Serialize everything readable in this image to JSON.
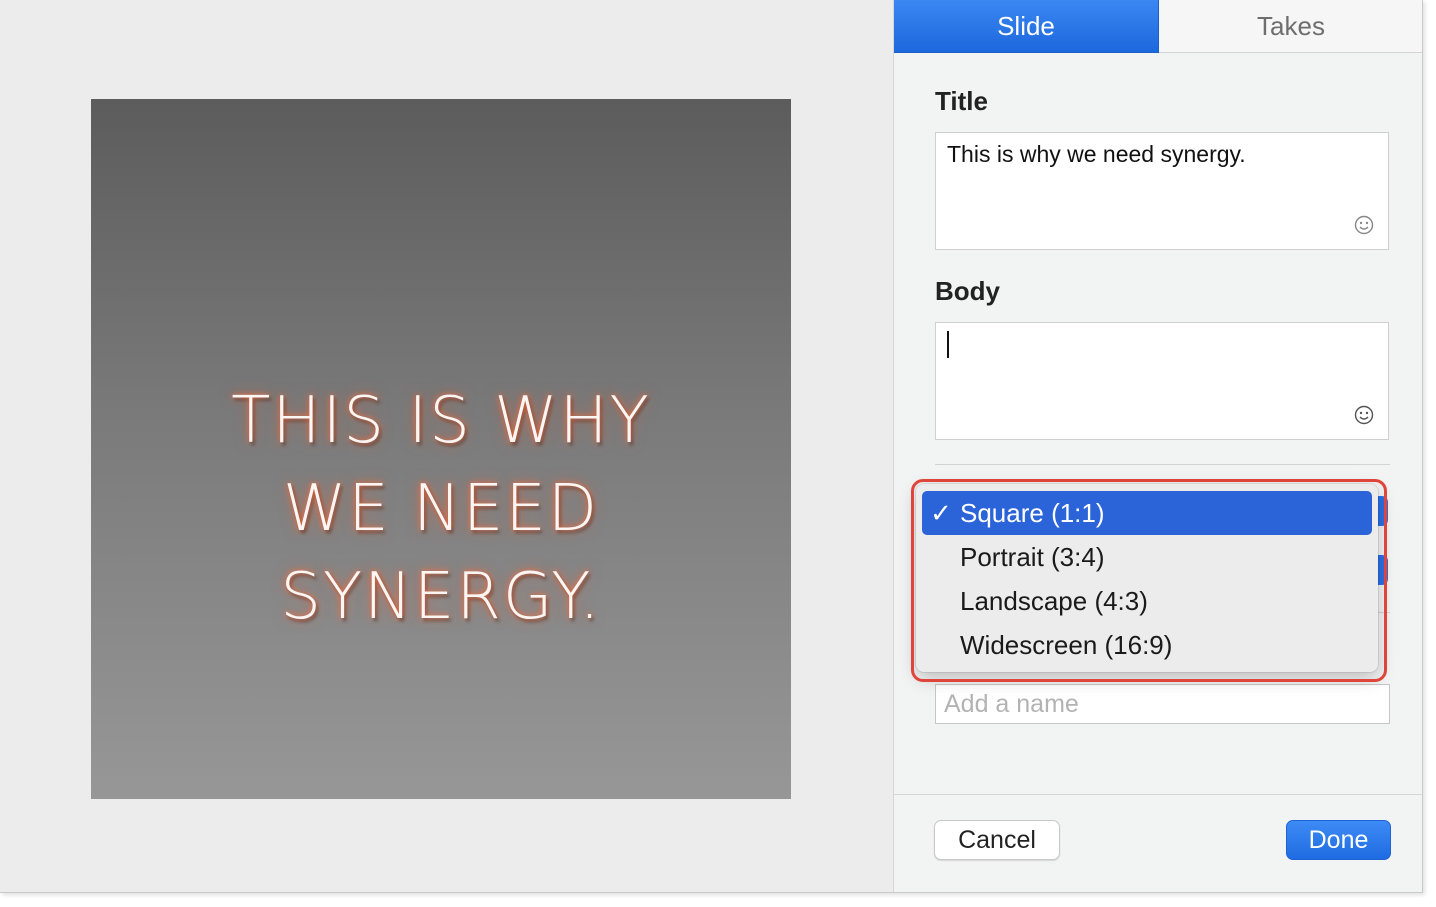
{
  "preview": {
    "slide_text": "This is why we need synergy."
  },
  "tabs": [
    {
      "label": "Slide",
      "active": true
    },
    {
      "label": "Takes",
      "active": false
    }
  ],
  "fields": {
    "title_label": "Title",
    "title_value": "This is why we need synergy.",
    "body_label": "Body",
    "body_value": ""
  },
  "aspect_menu": {
    "selected": "Square (1:1)",
    "check_glyph": "✓",
    "options": [
      "Square (1:1)",
      "Portrait (3:4)",
      "Landscape (4:3)",
      "Widescreen (16:9)"
    ]
  },
  "name_input": {
    "placeholder": "Add a name",
    "value": ""
  },
  "footer": {
    "cancel_label": "Cancel",
    "done_label": "Done"
  },
  "colors": {
    "accent": "#1c68dd",
    "menu_selected": "#2b63d8",
    "annotation_outline": "#e0453a",
    "neon_glow": "#ff6b3a"
  }
}
